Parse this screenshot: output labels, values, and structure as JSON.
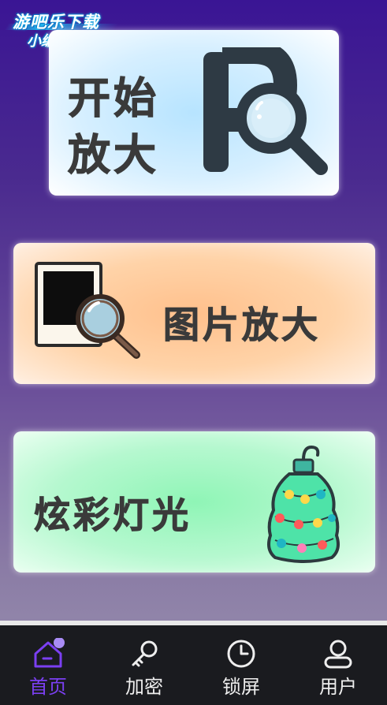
{
  "watermark": {
    "line1": "游吧乐下载",
    "line2": "小编亲测"
  },
  "cards": {
    "magnify": {
      "line1": "开始",
      "line2": "放大",
      "icon": "letter-p-magnifier-icon",
      "color": "#b7e4ff"
    },
    "photo": {
      "label": "图片放大",
      "icon": "photo-magnifier-icon",
      "color": "#ffc08c"
    },
    "lights": {
      "label": "炫彩灯光",
      "icon": "ornament-lights-icon",
      "color": "#8ff5b6"
    }
  },
  "tabbar": {
    "active_color": "#7b3ff2",
    "items": [
      {
        "label": "首页",
        "icon": "home-icon",
        "active": true
      },
      {
        "label": "加密",
        "icon": "key-icon",
        "active": false
      },
      {
        "label": "锁屏",
        "icon": "clock-icon",
        "active": false
      },
      {
        "label": "用户",
        "icon": "user-icon",
        "active": false
      }
    ]
  }
}
